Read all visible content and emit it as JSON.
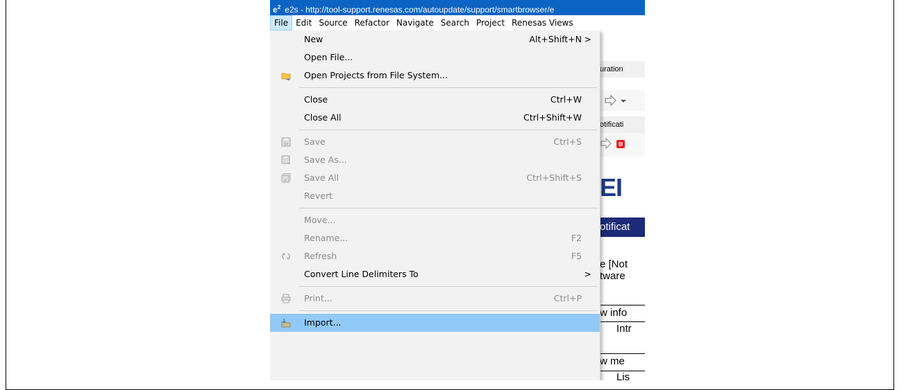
{
  "window": {
    "app_logo": "e",
    "app_logo_sup": "2",
    "title": "e2s - http://tool-support.renesas.com/autoupdate/support/smartbrowser/e"
  },
  "menubar": {
    "items": [
      "File",
      "Edit",
      "Source",
      "Refactor",
      "Navigate",
      "Search",
      "Project",
      "Renesas Views"
    ]
  },
  "background": {
    "tab_fragment": "uration",
    "notif_fragment": "otificati",
    "logo_fragment": "EI",
    "banner_fragment": "otificat",
    "text1": "e [Not",
    "text2": "tware",
    "text3": "w info",
    "text4": "Intr",
    "text5": "w me",
    "text6": "Lis"
  },
  "file_menu": {
    "items": [
      {
        "label": "New",
        "shortcut": "Alt+Shift+N",
        "arrow": ">",
        "icon": ""
      },
      {
        "label": "Open File...",
        "shortcut": "",
        "icon": ""
      },
      {
        "label": "Open Projects from File System...",
        "shortcut": "",
        "icon": "folder-icon"
      },
      {
        "label": "Close",
        "shortcut": "Ctrl+W",
        "icon": ""
      },
      {
        "label": "Close All",
        "shortcut": "Ctrl+Shift+W",
        "icon": ""
      },
      {
        "label": "Save",
        "shortcut": "Ctrl+S",
        "icon": "save-icon",
        "disabled": true
      },
      {
        "label": "Save As...",
        "shortcut": "",
        "icon": "save-as-icon",
        "disabled": true
      },
      {
        "label": "Save All",
        "shortcut": "Ctrl+Shift+S",
        "icon": "save-all-icon",
        "disabled": true
      },
      {
        "label": "Revert",
        "shortcut": "",
        "icon": "",
        "disabled": true
      },
      {
        "label": "Move...",
        "shortcut": "",
        "icon": "",
        "disabled": true
      },
      {
        "label": "Rename...",
        "shortcut": "F2",
        "icon": "",
        "disabled": true
      },
      {
        "label": "Refresh",
        "shortcut": "F5",
        "icon": "refresh-icon",
        "disabled": true
      },
      {
        "label": "Convert Line Delimiters To",
        "shortcut": "",
        "arrow": ">",
        "icon": ""
      },
      {
        "label": "Print...",
        "shortcut": "Ctrl+P",
        "icon": "print-icon",
        "disabled": true
      },
      {
        "label": "Import...",
        "shortcut": "",
        "icon": "import-icon",
        "selected": true
      }
    ]
  }
}
